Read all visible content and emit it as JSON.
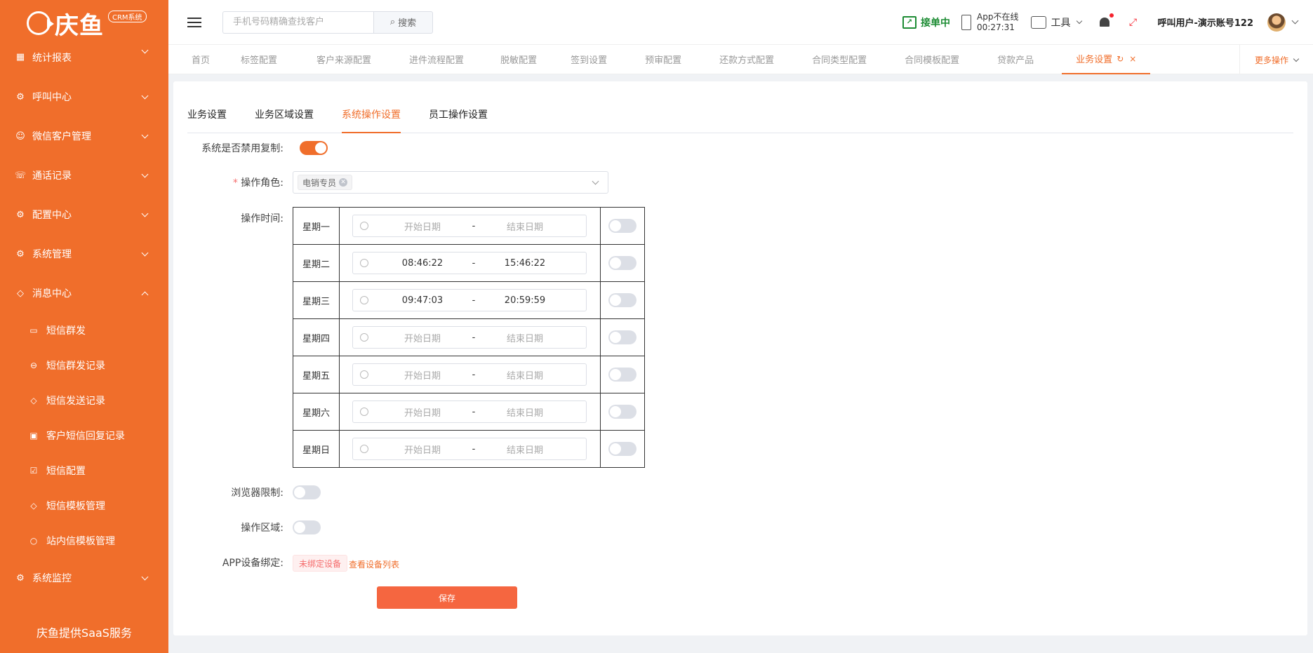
{
  "sidebar": {
    "logo_text": "庆鱼",
    "logo_badge": "CRM系统",
    "menu": [
      {
        "label": "统计报表"
      },
      {
        "label": "呼叫中心"
      },
      {
        "label": "微信客户管理"
      },
      {
        "label": "通话记录"
      },
      {
        "label": "配置中心"
      },
      {
        "label": "系统管理"
      },
      {
        "label": "消息中心"
      }
    ],
    "submenu": [
      {
        "label": "短信群发"
      },
      {
        "label": "短信群发记录"
      },
      {
        "label": "短信发送记录"
      },
      {
        "label": "客户短信回复记录"
      },
      {
        "label": "短信配置"
      },
      {
        "label": "短信模板管理"
      },
      {
        "label": "站内信模板管理"
      }
    ],
    "monitor": {
      "label": "系统监控"
    },
    "footer": "庆鱼提供SaaS服务",
    "bg_color": "#f06e2b"
  },
  "header": {
    "search_placeholder": "手机号码精确查找客户",
    "search_button": "搜索",
    "status_take": "接单中",
    "app_status_line1": "App不在线",
    "app_status_line2": "00:27:31",
    "tools": "工具",
    "user_name": "呼叫用户-演示账号122"
  },
  "tabs": {
    "items": [
      {
        "label": "首页"
      },
      {
        "label": "标签配置"
      },
      {
        "label": "客户来源配置"
      },
      {
        "label": "进件流程配置"
      },
      {
        "label": "脱敏配置"
      },
      {
        "label": "签到设置"
      },
      {
        "label": "预审配置"
      },
      {
        "label": "还款方式配置"
      },
      {
        "label": "合同类型配置"
      },
      {
        "label": "合同模板配置"
      },
      {
        "label": "贷款产品"
      }
    ],
    "active": "业务设置",
    "more": "更多操作",
    "accent": "#f06e2b"
  },
  "subtabs": [
    {
      "label": "业务设置"
    },
    {
      "label": "业务区域设置"
    },
    {
      "label": "系统操作设置"
    },
    {
      "label": "员工操作设置"
    }
  ],
  "form": {
    "disable_copy_label": "系统是否禁用复制:",
    "disable_copy_on": true,
    "role_label": "操作角色:",
    "role_tag": "电销专员",
    "time_label": "操作时间:",
    "schedule": [
      {
        "day": "星期一",
        "start": "",
        "end": "",
        "enabled": false
      },
      {
        "day": "星期二",
        "start": "08:46:22",
        "end": "15:46:22",
        "enabled": false
      },
      {
        "day": "星期三",
        "start": "09:47:03",
        "end": "20:59:59",
        "enabled": false
      },
      {
        "day": "星期四",
        "start": "",
        "end": "",
        "enabled": false
      },
      {
        "day": "星期五",
        "start": "",
        "end": "",
        "enabled": false
      },
      {
        "day": "星期六",
        "start": "",
        "end": "",
        "enabled": false
      },
      {
        "day": "星期日",
        "start": "",
        "end": "",
        "enabled": false
      }
    ],
    "start_placeholder": "开始日期",
    "end_placeholder": "结束日期",
    "range_separator": "-",
    "browser_limit_label": "浏览器限制:",
    "browser_limit_on": false,
    "area_label": "操作区域:",
    "area_on": false,
    "app_bind_label": "APP设备绑定:",
    "app_bind_status": "未绑定设备",
    "app_bind_link": "查看设备列表",
    "save": "保存"
  }
}
